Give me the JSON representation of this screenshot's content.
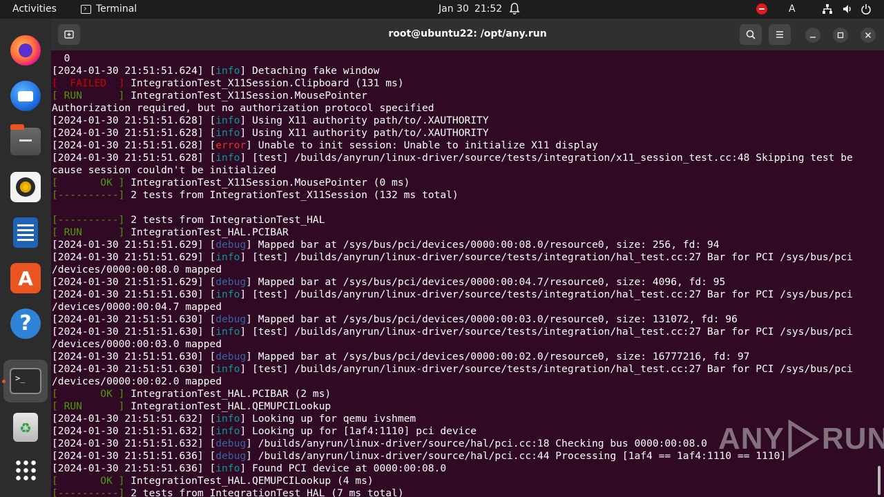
{
  "topbar": {
    "activities": "Activities",
    "app_name": "Terminal",
    "date": "Jan 30",
    "time": "21:52",
    "lang": "A"
  },
  "dock": {
    "items": [
      "Firefox",
      "Thunderbird",
      "Files",
      "Rhythmbox",
      "LibreOffice Writer",
      "Ubuntu Software",
      "Help",
      "Terminal",
      "Trash",
      "Show Applications"
    ],
    "active": "Terminal"
  },
  "window": {
    "title": "root@ubuntu22: /opt/any.run"
  },
  "terminal": {
    "lines": [
      {
        "text": "  0"
      },
      {
        "pre": "[2024-01-30 21:51:51.624] [",
        "tag": "info",
        "cls": "tag-info",
        "post": "] Detaching fake window"
      },
      {
        "pre": "",
        "tag": "[  FAILED  ]",
        "cls": "tag-failed",
        "post": " IntegrationTest_X11Session.Clipboard (131 ms)"
      },
      {
        "pre": "",
        "tag": "[ RUN      ]",
        "cls": "tag-run",
        "post": " IntegrationTest_X11Session.MousePointer"
      },
      {
        "text": "Authorization required, but no authorization protocol specified"
      },
      {
        "pre": "[2024-01-30 21:51:51.628] [",
        "tag": "info",
        "cls": "tag-info",
        "post": "] Using X11 authority path/to/.XAUTHORITY"
      },
      {
        "pre": "[2024-01-30 21:51:51.628] [",
        "tag": "info",
        "cls": "tag-info",
        "post": "] Using X11 authority path/to/.XAUTHORITY"
      },
      {
        "pre": "[2024-01-30 21:51:51.628] [",
        "tag": "error",
        "cls": "tag-error",
        "post": "] Unable to init session: Unable to initialize X11 display"
      },
      {
        "pre": "[2024-01-30 21:51:51.628] [",
        "tag": "info",
        "cls": "tag-info",
        "post": "] [test] /builds/anyrun/linux-driver/source/tests/integration/x11_session_test.cc:48 Skipping test be"
      },
      {
        "text": "cause session couldn't be initialized"
      },
      {
        "pre": "",
        "tag": "[       OK ]",
        "cls": "tag-ok",
        "post": " IntegrationTest_X11Session.MousePointer (0 ms)"
      },
      {
        "pre": "",
        "tag": "[----------]",
        "cls": "tag-sep",
        "post": " 2 tests from IntegrationTest_X11Session (132 ms total)"
      },
      {
        "text": ""
      },
      {
        "pre": "",
        "tag": "[----------]",
        "cls": "tag-sep",
        "post": " 2 tests from IntegrationTest_HAL"
      },
      {
        "pre": "",
        "tag": "[ RUN      ]",
        "cls": "tag-run",
        "post": " IntegrationTest_HAL.PCIBAR"
      },
      {
        "pre": "[2024-01-30 21:51:51.629] [",
        "tag": "debug",
        "cls": "tag-debug",
        "post": "] Mapped bar at /sys/bus/pci/devices/0000:00:08.0/resource0, size: 256, fd: 94"
      },
      {
        "pre": "[2024-01-30 21:51:51.629] [",
        "tag": "info",
        "cls": "tag-info",
        "post": "] [test] /builds/anyrun/linux-driver/source/tests/integration/hal_test.cc:27 Bar for PCI /sys/bus/pci"
      },
      {
        "text": "/devices/0000:00:08.0 mapped"
      },
      {
        "pre": "[2024-01-30 21:51:51.629] [",
        "tag": "debug",
        "cls": "tag-debug",
        "post": "] Mapped bar at /sys/bus/pci/devices/0000:00:04.7/resource0, size: 4096, fd: 95"
      },
      {
        "pre": "[2024-01-30 21:51:51.630] [",
        "tag": "info",
        "cls": "tag-info",
        "post": "] [test] /builds/anyrun/linux-driver/source/tests/integration/hal_test.cc:27 Bar for PCI /sys/bus/pci"
      },
      {
        "text": "/devices/0000:00:04.7 mapped"
      },
      {
        "pre": "[2024-01-30 21:51:51.630] [",
        "tag": "debug",
        "cls": "tag-debug",
        "post": "] Mapped bar at /sys/bus/pci/devices/0000:00:03.0/resource0, size: 131072, fd: 96"
      },
      {
        "pre": "[2024-01-30 21:51:51.630] [",
        "tag": "info",
        "cls": "tag-info",
        "post": "] [test] /builds/anyrun/linux-driver/source/tests/integration/hal_test.cc:27 Bar for PCI /sys/bus/pci"
      },
      {
        "text": "/devices/0000:00:03.0 mapped"
      },
      {
        "pre": "[2024-01-30 21:51:51.630] [",
        "tag": "debug",
        "cls": "tag-debug",
        "post": "] Mapped bar at /sys/bus/pci/devices/0000:00:02.0/resource0, size: 16777216, fd: 97"
      },
      {
        "pre": "[2024-01-30 21:51:51.630] [",
        "tag": "info",
        "cls": "tag-info",
        "post": "] [test] /builds/anyrun/linux-driver/source/tests/integration/hal_test.cc:27 Bar for PCI /sys/bus/pci"
      },
      {
        "text": "/devices/0000:00:02.0 mapped"
      },
      {
        "pre": "",
        "tag": "[       OK ]",
        "cls": "tag-ok",
        "post": " IntegrationTest_HAL.PCIBAR (2 ms)"
      },
      {
        "pre": "",
        "tag": "[ RUN      ]",
        "cls": "tag-run",
        "post": " IntegrationTest_HAL.QEMUPCILookup"
      },
      {
        "pre": "[2024-01-30 21:51:51.632] [",
        "tag": "info",
        "cls": "tag-info",
        "post": "] Looking up for qemu ivshmem"
      },
      {
        "pre": "[2024-01-30 21:51:51.632] [",
        "tag": "info",
        "cls": "tag-info",
        "post": "] Looking up for [1af4:1110] pci device"
      },
      {
        "pre": "[2024-01-30 21:51:51.632] [",
        "tag": "debug",
        "cls": "tag-debug",
        "post": "] /builds/anyrun/linux-driver/source/hal/pci.cc:18 Checking bus 0000:00:08.0"
      },
      {
        "pre": "[2024-01-30 21:51:51.636] [",
        "tag": "debug",
        "cls": "tag-debug",
        "post": "] /builds/anyrun/linux-driver/source/hal/pci.cc:44 Processing [1af4 == 1af4:1110 == 1110]"
      },
      {
        "pre": "[2024-01-30 21:51:51.636] [",
        "tag": "info",
        "cls": "tag-info",
        "post": "] Found PCI device at 0000:00:08.0"
      },
      {
        "pre": "",
        "tag": "[       OK ]",
        "cls": "tag-ok",
        "post": " IntegrationTest_HAL.QEMUPCILookup (4 ms)"
      },
      {
        "pre": "",
        "tag": "[----------]",
        "cls": "tag-sep",
        "post": " 2 tests from IntegrationTest_HAL (7 ms total)"
      }
    ]
  },
  "watermark": {
    "left": "ANY",
    "right": "RUN"
  },
  "colors": {
    "terminal_bg": "#300a24",
    "info": "#06989a",
    "debug": "#3465a4",
    "error": "#ef2929",
    "ok": "#4e9a06",
    "accent": "#e95420"
  }
}
